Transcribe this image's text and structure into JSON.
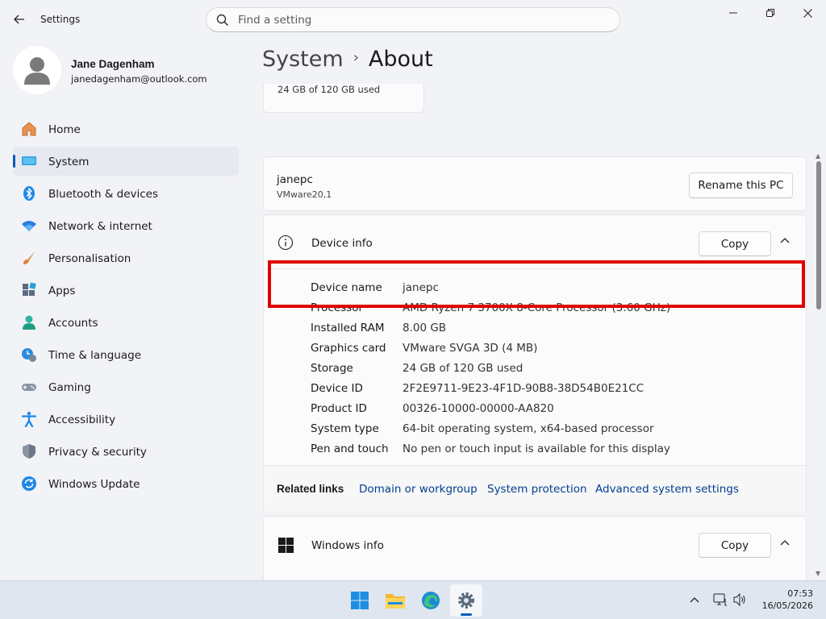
{
  "window": {
    "app_title": "Settings",
    "search_placeholder": "Find a setting"
  },
  "profile": {
    "name": "Jane Dagenham",
    "email": "janedagenham@outlook.com"
  },
  "nav": [
    {
      "label": "Home",
      "icon": "home-icon"
    },
    {
      "label": "System",
      "icon": "system-icon",
      "selected": true
    },
    {
      "label": "Bluetooth & devices",
      "icon": "bluetooth-icon"
    },
    {
      "label": "Network & internet",
      "icon": "wifi-icon"
    },
    {
      "label": "Personalisation",
      "icon": "brush-icon"
    },
    {
      "label": "Apps",
      "icon": "apps-icon"
    },
    {
      "label": "Accounts",
      "icon": "accounts-icon"
    },
    {
      "label": "Time & language",
      "icon": "time-language-icon"
    },
    {
      "label": "Gaming",
      "icon": "gaming-icon"
    },
    {
      "label": "Accessibility",
      "icon": "accessibility-icon"
    },
    {
      "label": "Privacy & security",
      "icon": "shield-icon"
    },
    {
      "label": "Windows Update",
      "icon": "update-icon"
    }
  ],
  "breadcrumb": {
    "parent": "System",
    "separator": "›",
    "current": "About"
  },
  "storage_card": {
    "text": "24 GB of 120 GB used"
  },
  "pc_card": {
    "hostname": "janepc",
    "model": "VMware20,1",
    "rename_button": "Rename this PC"
  },
  "device_info": {
    "title": "Device info",
    "copy_button": "Copy",
    "specs": [
      {
        "key": "Device name",
        "value": "janepc"
      },
      {
        "key": "Processor",
        "value": "AMD Ryzen 7 3700X 8-Core Processor (3.60 GHz)"
      },
      {
        "key": "Installed RAM",
        "value": "8.00 GB"
      },
      {
        "key": "Graphics card",
        "value": "VMware SVGA 3D (4 MB)"
      },
      {
        "key": "Storage",
        "value": "24 GB of 120 GB used"
      },
      {
        "key": "Device ID",
        "value": "2F2E9711-9E23-4F1D-90B8-38D54B0E21CC"
      },
      {
        "key": "Product ID",
        "value": "00326-10000-00000-AA820"
      },
      {
        "key": "System type",
        "value": "64-bit operating system, x64-based processor"
      },
      {
        "key": "Pen and touch",
        "value": "No pen or touch input is available for this display"
      }
    ]
  },
  "related_links": {
    "label": "Related links",
    "links": [
      "Domain or workgroup",
      "System protection",
      "Advanced system settings"
    ]
  },
  "windows_info": {
    "title": "Windows info",
    "copy_button": "Copy"
  },
  "highlight_color": "#e00000",
  "accent_color": "#005fb8",
  "taskbar": {
    "apps": [
      "start-icon",
      "file-explorer-icon",
      "edge-icon",
      "settings-icon"
    ],
    "time": "07:53",
    "date": "16/05/2026"
  }
}
